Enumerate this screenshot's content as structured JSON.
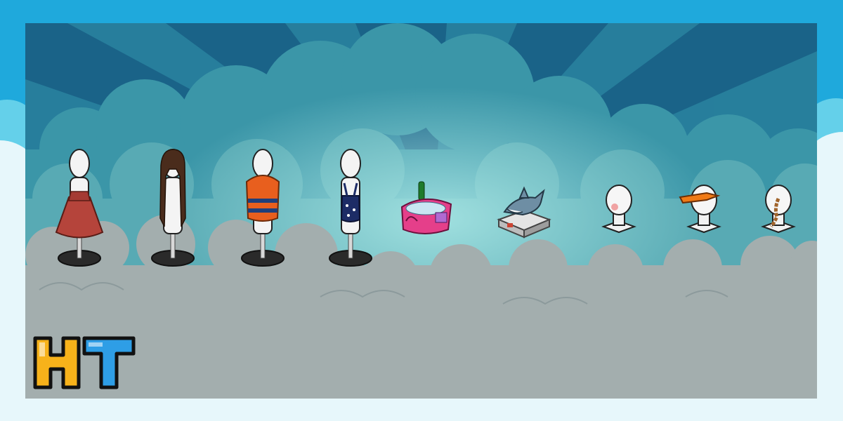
{
  "banner": {
    "logo": {
      "text": "HT",
      "letter_h_color": "#f7b21a",
      "letter_t_color": "#2e9ee6",
      "outline_color": "#111111"
    },
    "colors": {
      "frame_blue": "#1fa9dc",
      "sky_top": "#1a6388",
      "sky_mid": "#2a8aa6",
      "cloud_back": "#4ba6b2",
      "cloud_front": "#a3aeae",
      "outer_cloud_light": "#e7f7fb",
      "outer_cloud_cyan": "#64d0ea"
    }
  },
  "furni_items": [
    {
      "name": "mannequin-red-dress",
      "kind": "mannequin",
      "accessory": "red-ruffled-dress",
      "color": "#b5443b"
    },
    {
      "name": "mannequin-long-brown-hair",
      "kind": "mannequin",
      "accessory": "long-brown-hair",
      "color": "#4a2c1c"
    },
    {
      "name": "mannequin-orange-life-vest",
      "kind": "mannequin",
      "accessory": "life-vest",
      "color": "#e85f1e"
    },
    {
      "name": "mannequin-navy-swimsuit",
      "kind": "mannequin",
      "accessory": "navy-swimsuit",
      "color": "#1d2c66"
    },
    {
      "name": "pink-beach-bag",
      "kind": "bag",
      "accessory": "champagne-bottle",
      "color": "#e53f8a"
    },
    {
      "name": "shark-plush-on-crate",
      "kind": "plush",
      "accessory": "grey-crate",
      "color": "#6e8ea4"
    },
    {
      "name": "head-bust-blush",
      "kind": "bust",
      "accessory": "pink-cheeks",
      "color": "#f0a3a3"
    },
    {
      "name": "head-bust-orange-visor",
      "kind": "bust",
      "accessory": "orange-visor",
      "color": "#f07a16"
    },
    {
      "name": "head-bust-braid",
      "kind": "bust",
      "accessory": "brown-braid",
      "color": "#a0632a"
    }
  ]
}
